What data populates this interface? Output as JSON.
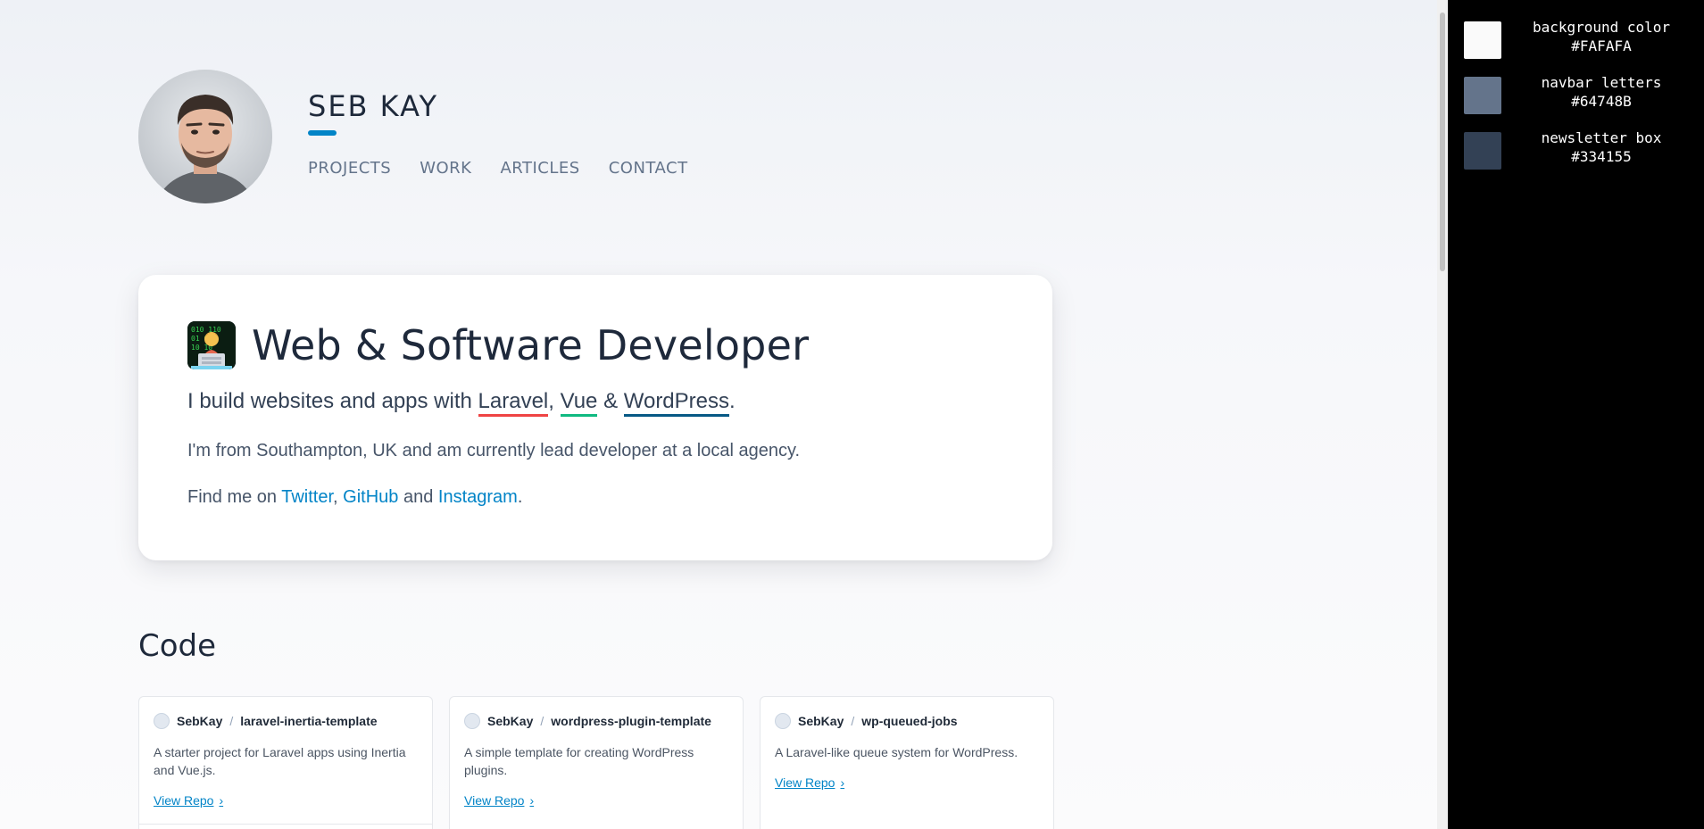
{
  "site": {
    "title": "SEB KAY",
    "nav": [
      "PROJECTS",
      "WORK",
      "ARTICLES",
      "CONTACT"
    ]
  },
  "intro": {
    "heading": "Web & Software Developer",
    "line1_prefix": "I build websites and apps with ",
    "tech": [
      "Laravel",
      "Vue",
      "WordPress"
    ],
    "sep_comma": ", ",
    "sep_amp": " & ",
    "line1_suffix": ".",
    "line2": "I'm from Southampton, UK and am currently lead developer at a local agency.",
    "line3_prefix": "Find me on ",
    "social": [
      "Twitter",
      "GitHub",
      "Instagram"
    ],
    "line3_sep_and": " and ",
    "line3_suffix": "."
  },
  "code": {
    "heading": "Code",
    "repos": [
      {
        "owner": "SebKay",
        "name": "laravel-inertia-template",
        "description": "A starter project for Laravel apps using Inertia and Vue.js.",
        "link": "View Repo"
      },
      {
        "owner": "SebKay",
        "name": "wordpress-plugin-template",
        "description": "A simple template for creating WordPress plugins.",
        "link": "View Repo"
      },
      {
        "owner": "SebKay",
        "name": "wp-queued-jobs",
        "description": "A Laravel-like queue system for WordPress.",
        "link": "View Repo"
      }
    ],
    "slash": "/"
  },
  "palette": [
    {
      "label": "background color",
      "hex": "#FAFAFA",
      "color": "#FAFAFA"
    },
    {
      "label": "navbar letters",
      "hex": "#64748B",
      "color": "#64748B"
    },
    {
      "label": "newsletter box",
      "hex": "#334155",
      "color": "#334155"
    }
  ],
  "colors": {
    "accent": "#0284c7",
    "laravel": "#ef4444",
    "vue": "#10b981",
    "wordpress": "#075985"
  },
  "icons": {
    "avatar": "profile-photo",
    "heading": "technologist-emoji",
    "repo_link": "chevron-right-icon"
  }
}
